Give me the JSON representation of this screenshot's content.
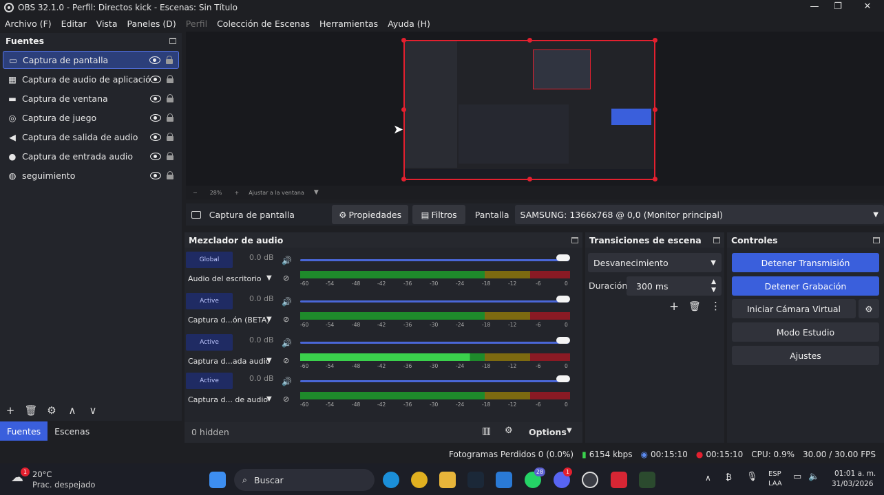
{
  "window": {
    "title": "OBS 32.1.0 - Perfil: Directos kick - Escenas: Sin Título",
    "minimize": "—",
    "maximize": "❐",
    "close": "✕"
  },
  "menu": [
    "Archivo (F)",
    "Editar",
    "Vista",
    "Paneles (D)",
    "Perfil",
    "Colección de Escenas",
    "Herramientas",
    "Ayuda (H)"
  ],
  "sources": {
    "title": "Fuentes",
    "items": [
      {
        "label": "Captura de pantalla",
        "icon": "monitor-icon",
        "glyph": "▭"
      },
      {
        "label": "Captura de audio de aplicación (BETA)",
        "icon": "app-audio-icon",
        "glyph": "▦"
      },
      {
        "label": "Captura de ventana",
        "icon": "window-icon",
        "glyph": "▬"
      },
      {
        "label": "Captura de juego",
        "icon": "gamepad-icon",
        "glyph": "◎"
      },
      {
        "label": "Captura de salida de audio",
        "icon": "speaker-icon",
        "glyph": "◀"
      },
      {
        "label": "Captura de entrada audio",
        "icon": "microphone-icon",
        "glyph": "●"
      },
      {
        "label": "seguimiento",
        "icon": "browser-icon",
        "glyph": "◍"
      }
    ],
    "tools": [
      "+",
      "🗑",
      "⚙",
      "∧",
      "∨"
    ]
  },
  "tabs": {
    "sources": "Fuentes",
    "scenes": "Escenas"
  },
  "preview": {
    "zoom": "28%",
    "minus": "−",
    "plus": "+",
    "fit": "Ajustar a la ventana"
  },
  "propbar": {
    "source": "Captura de pantalla",
    "properties": "Propiedades",
    "filters": "Filtros",
    "display_label": "Pantalla",
    "display_value": "SAMSUNG: 1366x768 @ 0,0 (Monitor principal)"
  },
  "mixer": {
    "title": "Mezclador de audio",
    "hidden": "0 hidden",
    "options": "Options",
    "channels": [
      {
        "badge": "Global",
        "db": "0.0 dB",
        "name": "Audio del escritorio"
      },
      {
        "badge": "Active",
        "db": "0.0 dB",
        "name": "Captura d...ón (BETA)"
      },
      {
        "badge": "Active",
        "db": "0.0 dB",
        "name": "Captura d...ada audio"
      },
      {
        "badge": "Active",
        "db": "0.0 dB",
        "name": "Captura d... de audio"
      }
    ],
    "ticks": [
      "-60",
      "-54",
      "-48",
      "-42",
      "-36",
      "-30",
      "-24",
      "-18",
      "-12",
      "-6",
      "0"
    ]
  },
  "transitions": {
    "title": "Transiciones de escena",
    "selected": "Desvanecimiento",
    "duration_label": "Duración",
    "duration_value": "300 ms"
  },
  "controls": {
    "title": "Controles",
    "stop_stream": "Detener Transmisión",
    "stop_rec": "Detener Grabación",
    "virtual_cam": "Iniciar Cámara Virtual",
    "studio": "Modo Estudio",
    "settings": "Ajustes"
  },
  "status": {
    "dropped": "Fotogramas Perdidos 0 (0.0%)",
    "bitrate": "6154 kbps",
    "stream_time": "00:15:10",
    "rec_time": "00:15:10",
    "cpu": "CPU: 0.9%",
    "fps": "30.00 / 30.00 FPS"
  },
  "taskbar": {
    "weather_temp": "20°C",
    "weather_desc": "Prac. despejado",
    "search": "Buscar",
    "lang1": "ESP",
    "lang2": "LAA",
    "time": "01:01 a. m.",
    "date": "31/03/2026",
    "badge_whatsapp": "28",
    "badge_weather": "1",
    "badge_discord": "1"
  }
}
